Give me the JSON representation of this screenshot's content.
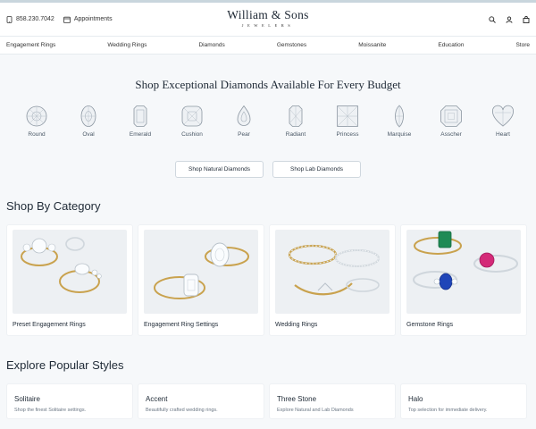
{
  "header": {
    "phone": "858.230.7042",
    "appointments": "Appointments",
    "logo_name": "William & Sons",
    "logo_sub": "JEWELERS"
  },
  "nav": [
    "Engagement Rings",
    "Wedding Rings",
    "Diamonds",
    "Gemstones",
    "Moissanite",
    "Education",
    "Store"
  ],
  "hero": {
    "title": "Shop Exceptional Diamonds Available For Every Budget",
    "shapes": [
      "Round",
      "Oval",
      "Emerald",
      "Cushion",
      "Pear",
      "Radiant",
      "Princess",
      "Marquise",
      "Asscher",
      "Heart"
    ],
    "buttons": {
      "natural": "Shop Natural Diamonds",
      "lab": "Shop Lab Diamonds"
    }
  },
  "category": {
    "title": "Shop By Category",
    "items": [
      "Preset Engagement Rings",
      "Engagement Ring Settings",
      "Wedding Rings",
      "Gemstone Rings"
    ]
  },
  "popular": {
    "title": "Explore Popular Styles",
    "items": [
      {
        "title": "Solitaire",
        "desc": "Shop the finest Solitaire settings."
      },
      {
        "title": "Accent",
        "desc": "Beautifully crafted wedding rings."
      },
      {
        "title": "Three Stone",
        "desc": "Explore Natural and Lab Diamonds"
      },
      {
        "title": "Halo",
        "desc": "Top selection for immediate delivery."
      }
    ]
  },
  "colors": {
    "accent_gold": "#caa04a",
    "emerald": "#1f8a55",
    "pink_sapphire": "#d42a78",
    "blue_sapphire": "#1f45b8"
  }
}
